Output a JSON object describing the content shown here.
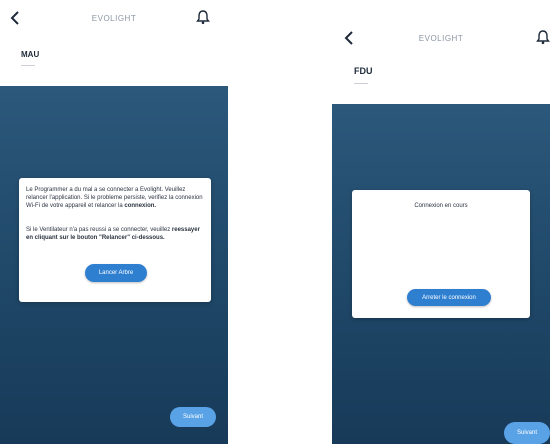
{
  "left_screen": {
    "title": "EVOLIGHT",
    "device_name": "MAU",
    "device_subtitle": "——",
    "dialog": {
      "paragraph_1": "Le Programmer a du mal a se connecter a Evolight. Veuillez relancer l'application. Si le probleme persiste, verifiez la connexion Wi-Fi de votre appareil et relancer la",
      "paragraph_1_emphasis": "connexion.",
      "paragraph_2": "Si le Ventilateur n'a pas reussi a se connecter, veuillez",
      "paragraph_2_emphasis": "reessayer en cliquant sur le bouton \"Relancer\" ci-dessous.",
      "button_label": "Lancer Arbre"
    },
    "corner_button_label": "Suivant"
  },
  "right_screen": {
    "title": "EVOLIGHT",
    "device_name": "FDU",
    "device_subtitle": "——",
    "dialog": {
      "heading": "Connexion en cours",
      "button_label": "Arreter le connexion"
    },
    "corner_button_label": "Suivant"
  },
  "colors": {
    "panel_top": "#2c587b",
    "panel_bottom": "#173a58",
    "primary_button": "#2f7fd1",
    "corner_button": "#5aa2e6"
  },
  "icons": {
    "back": "chevron-left-icon",
    "notifications": "bell-icon"
  }
}
